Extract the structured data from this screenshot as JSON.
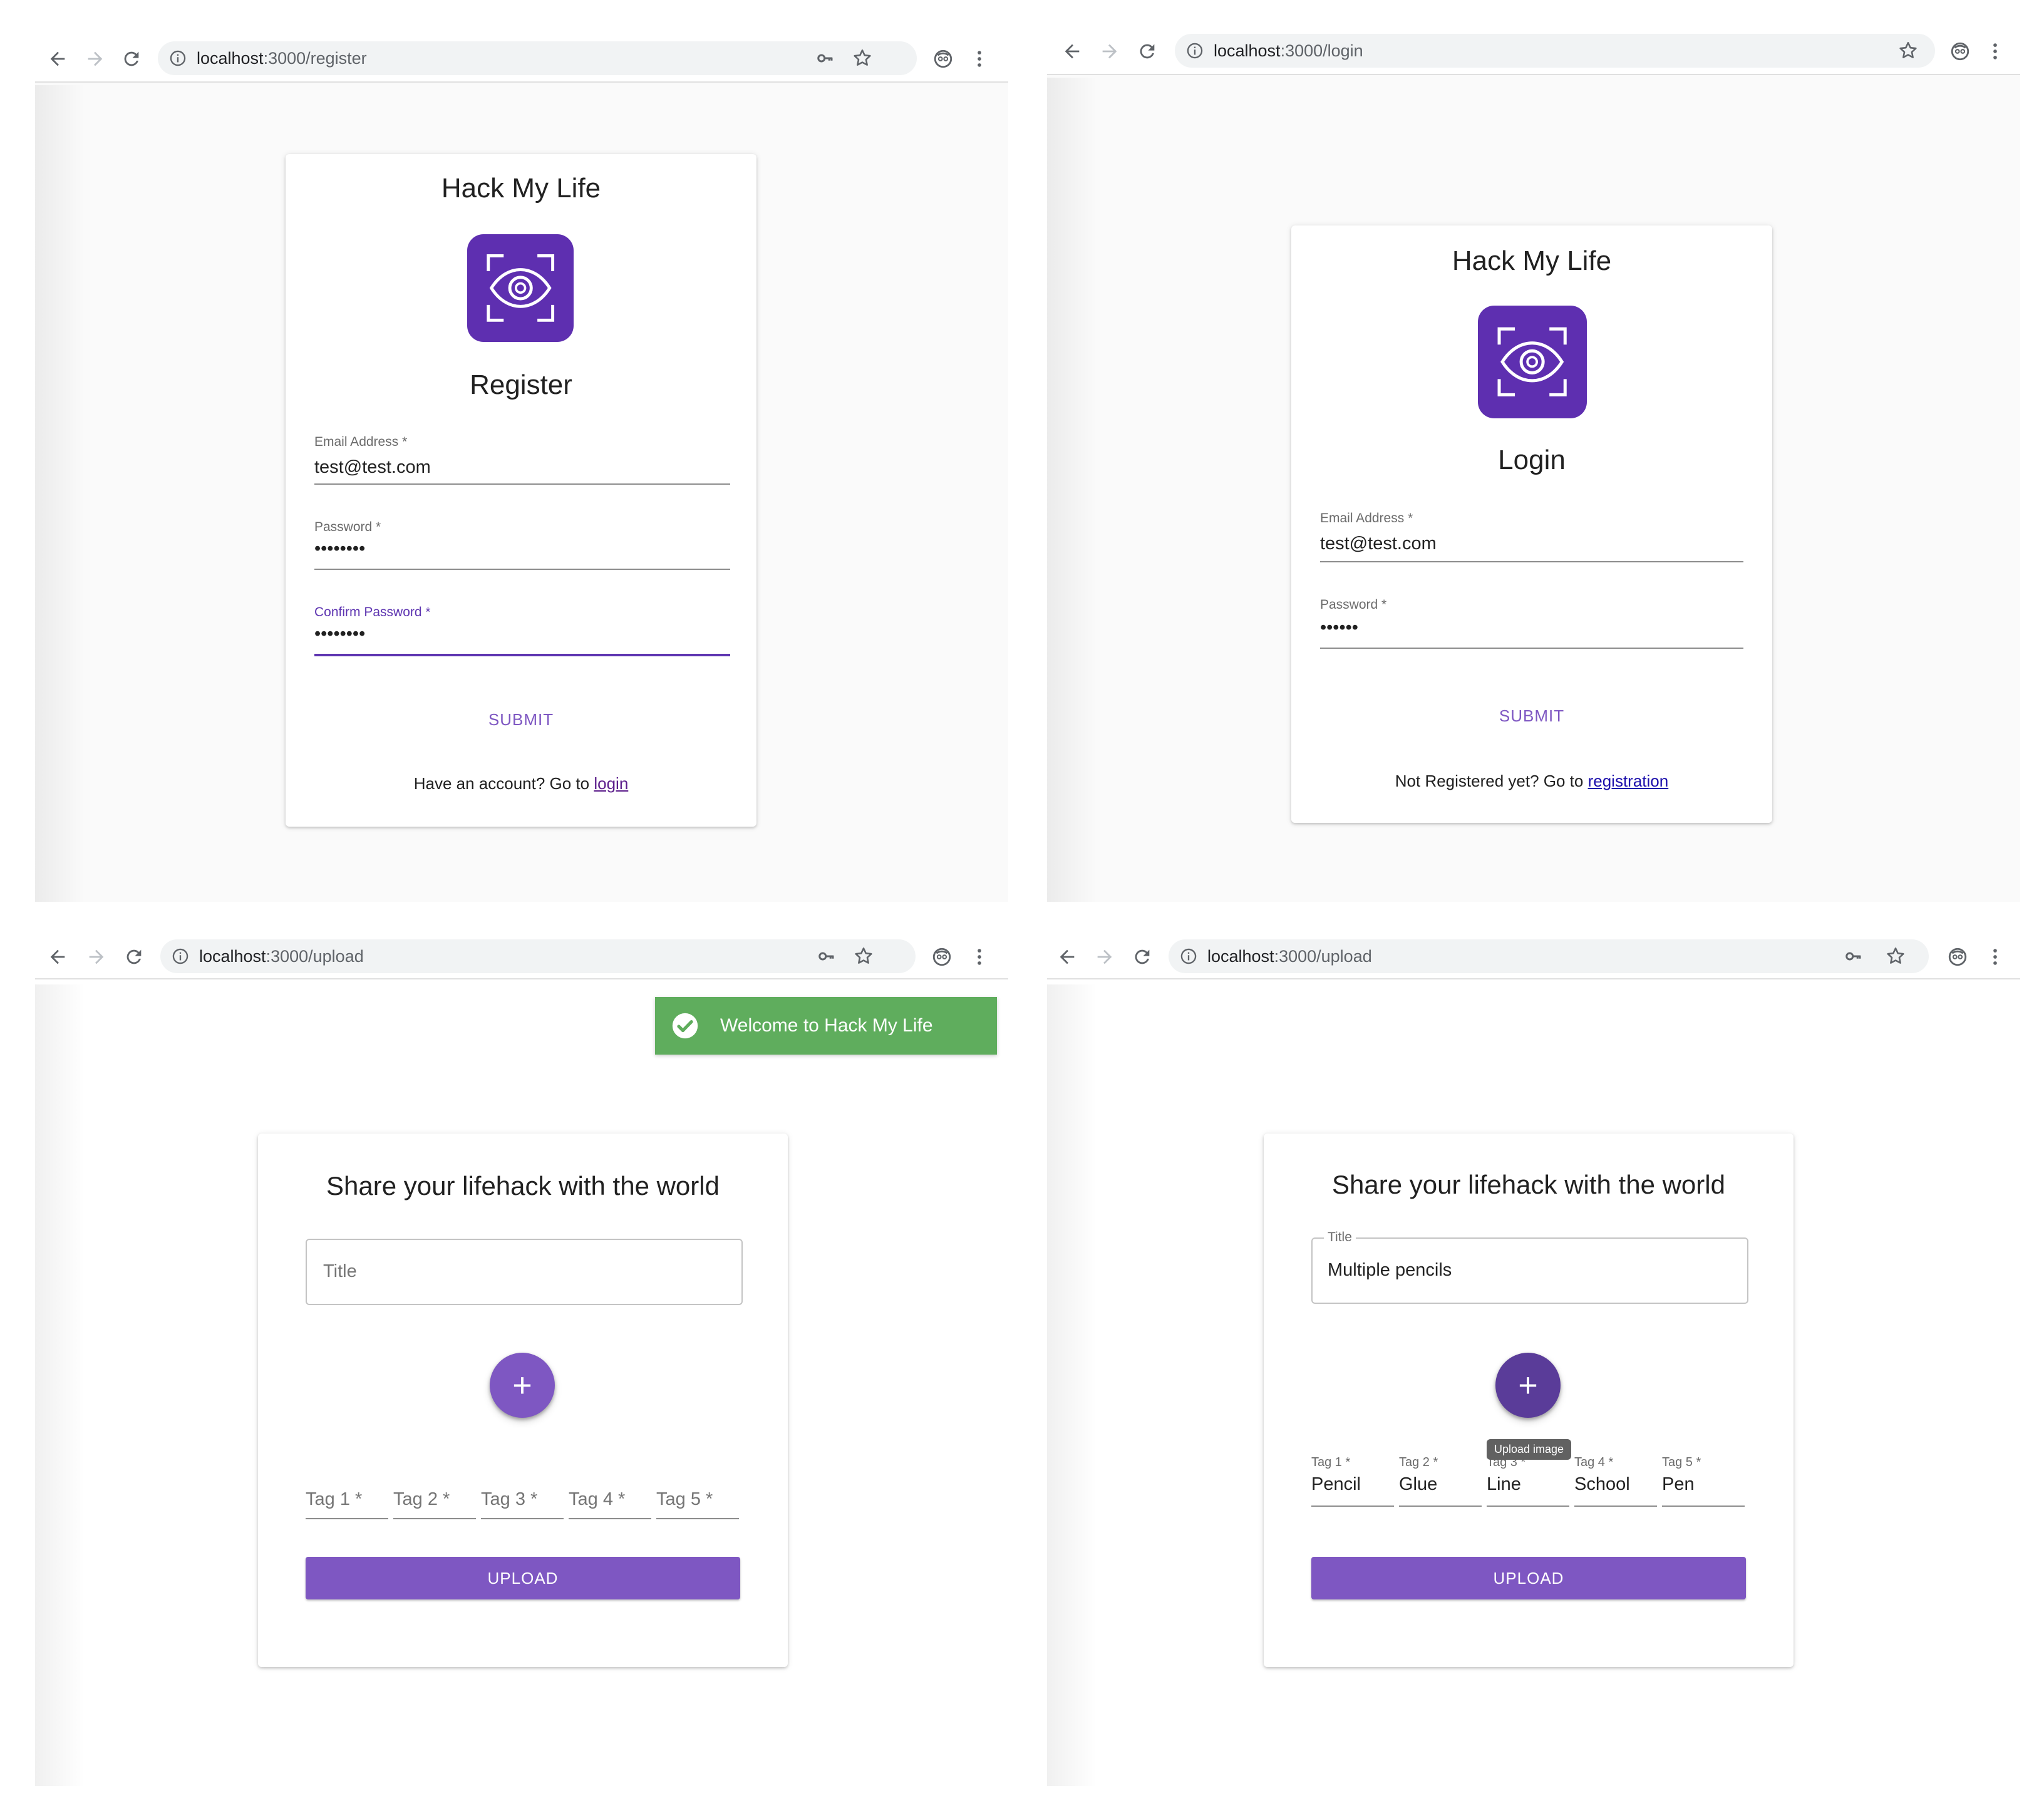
{
  "brand": {
    "accent": "#7e57c2",
    "logo_bg": "#5e2fb0",
    "snackbar_bg": "#5fad5d",
    "link": "#1a0dab"
  },
  "screens": [
    {
      "url_host": "localhost",
      "url_path": ":3000/register",
      "app_title": "Hack My Life",
      "form_title": "Register",
      "fields": [
        {
          "label": "Email Address",
          "required": "*",
          "value": "test@test.com"
        },
        {
          "label": "Password",
          "required": "*",
          "value": "••••••••"
        },
        {
          "label": "Confirm Password",
          "required": "*",
          "value": "••••••••"
        }
      ],
      "submit_label": "SUBMIT",
      "footer_text": "Have an account? Go to ",
      "footer_link": "login"
    },
    {
      "url_host": "localhost",
      "url_path": ":3000/login",
      "app_title": "Hack My Life",
      "form_title": "Login",
      "fields": [
        {
          "label": "Email Address",
          "required": "*",
          "value": "test@test.com"
        },
        {
          "label": "Password",
          "required": "*",
          "value": "••••••"
        }
      ],
      "submit_label": "SUBMIT",
      "footer_text": "Not Registered yet? Go to ",
      "footer_link": "registration"
    },
    {
      "url_host": "localhost",
      "url_path": ":3000/upload",
      "snackbar_text": "Welcome to Hack My Life",
      "heading": "Share your lifehack with the world",
      "title_placeholder": "Title",
      "fab_label": "+",
      "tags": [
        {
          "label": "Tag 1 *"
        },
        {
          "label": "Tag 2 *"
        },
        {
          "label": "Tag 3 *"
        },
        {
          "label": "Tag 4 *"
        },
        {
          "label": "Tag 5 *"
        }
      ],
      "upload_label": "UPLOAD"
    },
    {
      "url_host": "localhost",
      "url_path": ":3000/upload",
      "heading": "Share your lifehack with the world",
      "title_label": "Title",
      "title_value": "Multiple pencils",
      "fab_label": "+",
      "tooltip": "Upload image",
      "tags": [
        {
          "label": "Tag 1 *",
          "value": "Pencil"
        },
        {
          "label": "Tag 2 *",
          "value": "Glue"
        },
        {
          "label": "Tag 3 *",
          "value": "Line"
        },
        {
          "label": "Tag 4 *",
          "value": "School"
        },
        {
          "label": "Tag 5 *",
          "value": "Pen"
        }
      ],
      "upload_label": "UPLOAD"
    }
  ]
}
